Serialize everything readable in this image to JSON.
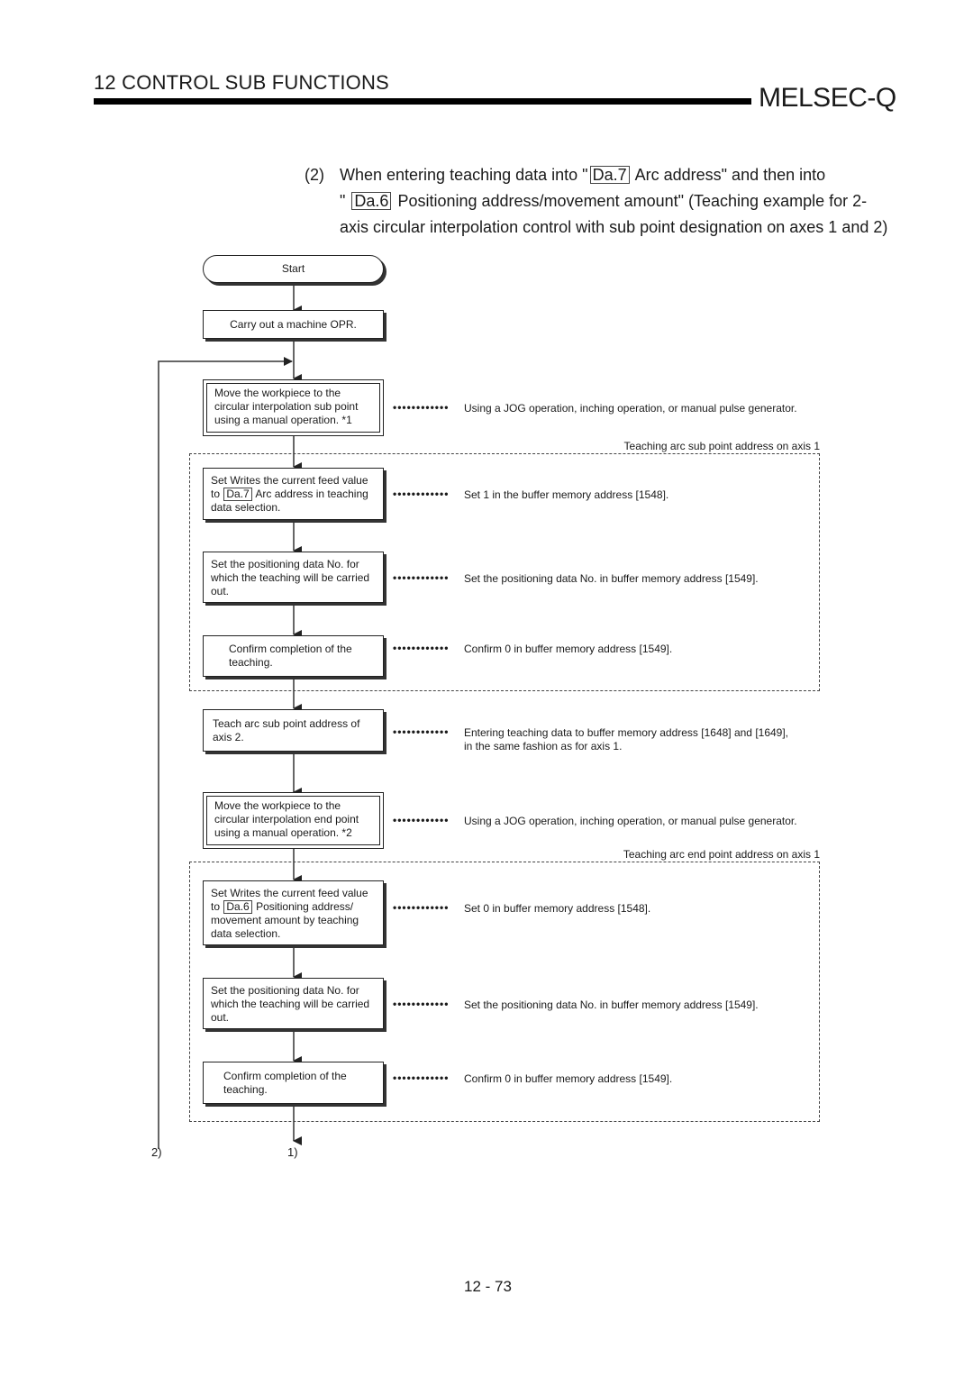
{
  "header": {
    "section_title": "12   CONTROL SUB FUNCTIONS",
    "brand": "MELSEC-Q"
  },
  "intro": {
    "number": "(2)",
    "line1_pre": "When entering teaching data into \"",
    "line1_tag": "Da.7",
    "line1_post": "Arc address\" and then into",
    "line2_pre": "\"",
    "line2_tag": "Da.6",
    "line2_post": "Positioning address/movement amount\" (Teaching example for 2-",
    "line3": "axis circular interpolation control with sub point designation on axes 1 and 2)"
  },
  "flow": {
    "start": "Start",
    "opr": "Carry out a machine OPR.",
    "move_sub": "Move the workpiece to the circular interpolation sub point using a manual operation.  *1",
    "move_sub_note": "Using a JOG operation, inching operation, or manual pulse generator.",
    "group1_label": "Teaching arc sub point address on axis 1",
    "set_writes_1_pre": "Set Writes the current feed value to",
    "set_writes_1_tag": "Da.7",
    "set_writes_1_post": "Arc address in teaching data selection.",
    "set_writes_1_note": "Set 1 in the buffer memory address [1548].",
    "set_no_1": "Set the positioning data No. for which the teaching will be carried out.",
    "set_no_1_note": "Set the positioning data No. in buffer memory address [1549].",
    "confirm_1": "Confirm completion of the teaching.",
    "confirm_1_note": "Confirm 0 in buffer memory address [1549].",
    "teach_axis2": "Teach arc sub point address of axis 2.",
    "teach_axis2_note_l1": "Entering teaching data to buffer memory address [1648] and [1649],",
    "teach_axis2_note_l2": "in the same fashion as for axis 1.",
    "move_end": "Move the workpiece to the circular interpolation end point using a manual operation.  *2",
    "move_end_note": "Using a JOG operation, inching operation, or manual pulse generator.",
    "group2_label": "Teaching arc end point address on axis 1",
    "set_writes_2_pre": "Set Writes the current feed value to",
    "set_writes_2_tag": "Da.6",
    "set_writes_2_post": "Positioning address/ movement amount by teaching data selection.",
    "set_writes_2_note": "Set 0 in buffer memory address [1548].",
    "set_no_2": "Set the positioning data No. for which the teaching will be carried out.",
    "set_no_2_note": "Set the positioning data No. in buffer memory address [1549].",
    "confirm_2": "Confirm completion of the teaching.",
    "confirm_2_note": "Confirm 0 in buffer memory address [1549].",
    "connector_left": "2)",
    "connector_main": "1)",
    "leader_dots": "••••••••••••"
  },
  "footer": {
    "page_number": "12 - 73"
  }
}
